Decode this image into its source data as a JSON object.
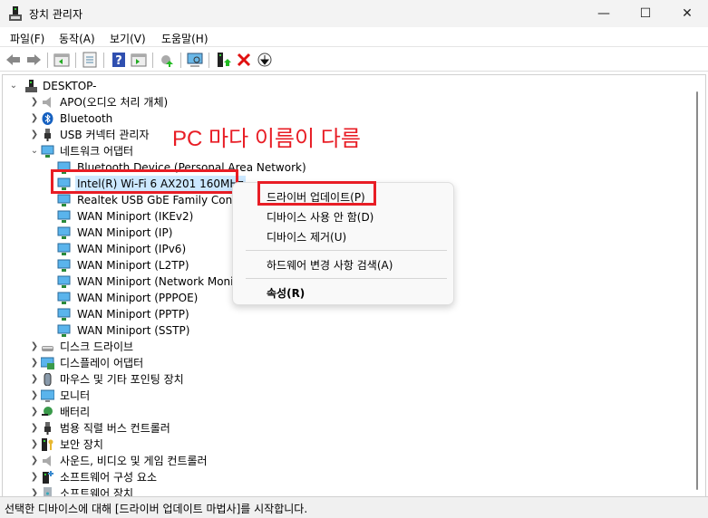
{
  "window": {
    "title": "장치 관리자",
    "minimize": "—",
    "maximize": "☐",
    "close": "✕"
  },
  "menu": [
    "파일(F)",
    "동작(A)",
    "보기(V)",
    "도움말(H)"
  ],
  "toolbar": {
    "icons": [
      "back-icon",
      "forward-icon",
      "show-hide-console-tree-icon",
      "properties-icon",
      "help-icon",
      "action-pane-icon",
      "update-driver-icon",
      "scan-hardware-icon",
      "add-driver-icon",
      "uninstall-icon",
      "disable-icon"
    ]
  },
  "tree": [
    {
      "level": 0,
      "label": "DESKTOP-",
      "state": "expanded",
      "icon": "computer-icon"
    },
    {
      "level": 1,
      "label": "APO(오디오 처리 개체)",
      "state": "collapsed",
      "icon": "speaker-icon"
    },
    {
      "level": 1,
      "label": "Bluetooth",
      "state": "collapsed",
      "icon": "bluetooth-icon"
    },
    {
      "level": 1,
      "label": "USB 커넥터 관리자",
      "state": "collapsed",
      "icon": "usb-icon"
    },
    {
      "level": 1,
      "label": "네트워크 어댑터",
      "state": "expanded",
      "icon": "network-icon"
    },
    {
      "level": 2,
      "label": "Bluetooth Device (Personal Area Network)",
      "icon": "network-icon"
    },
    {
      "level": 2,
      "label": "Intel(R) Wi-Fi 6 AX201 160MHz",
      "icon": "network-icon",
      "selected": true
    },
    {
      "level": 2,
      "label": "Realtek USB GbE Family Controller",
      "icon": "network-icon"
    },
    {
      "level": 2,
      "label": "WAN Miniport (IKEv2)",
      "icon": "network-icon"
    },
    {
      "level": 2,
      "label": "WAN Miniport (IP)",
      "icon": "network-icon"
    },
    {
      "level": 2,
      "label": "WAN Miniport (IPv6)",
      "icon": "network-icon"
    },
    {
      "level": 2,
      "label": "WAN Miniport (L2TP)",
      "icon": "network-icon"
    },
    {
      "level": 2,
      "label": "WAN Miniport (Network Monitor)",
      "icon": "network-icon"
    },
    {
      "level": 2,
      "label": "WAN Miniport (PPPOE)",
      "icon": "network-icon"
    },
    {
      "level": 2,
      "label": "WAN Miniport (PPTP)",
      "icon": "network-icon"
    },
    {
      "level": 2,
      "label": "WAN Miniport (SSTP)",
      "icon": "network-icon"
    },
    {
      "level": 1,
      "label": "디스크 드라이브",
      "state": "collapsed",
      "icon": "disk-icon"
    },
    {
      "level": 1,
      "label": "디스플레이 어댑터",
      "state": "collapsed",
      "icon": "display-adapter-icon"
    },
    {
      "level": 1,
      "label": "마우스 및 기타 포인팅 장치",
      "state": "collapsed",
      "icon": "mouse-icon"
    },
    {
      "level": 1,
      "label": "모니터",
      "state": "collapsed",
      "icon": "monitor-icon"
    },
    {
      "level": 1,
      "label": "배터리",
      "state": "collapsed",
      "icon": "battery-icon"
    },
    {
      "level": 1,
      "label": "범용 직렬 버스 컨트롤러",
      "state": "collapsed",
      "icon": "usb-icon"
    },
    {
      "level": 1,
      "label": "보안 장치",
      "state": "collapsed",
      "icon": "security-icon"
    },
    {
      "level": 1,
      "label": "사운드, 비디오 및 게임 컨트롤러",
      "state": "collapsed",
      "icon": "speaker-icon"
    },
    {
      "level": 1,
      "label": "소프트웨어 구성 요소",
      "state": "collapsed",
      "icon": "software-component-icon"
    },
    {
      "level": 1,
      "label": "소프트웨어 장치",
      "state": "collapsed",
      "icon": "software-device-icon"
    }
  ],
  "context_menu": {
    "items": [
      "드라이버 업데이트(P)",
      "디바이스 사용 안 함(D)",
      "디바이스 제거(U)",
      "하드웨어 변경 사항 검색(A)",
      "속성(R)"
    ]
  },
  "annotation": "PC 마다 이름이 다름",
  "status": "선택한 디바이스에 대해 [드라이버 업데이트 마법사]를 시작합니다.",
  "colors": {
    "highlight": "#e81d25",
    "selection": "#cce8ff"
  }
}
